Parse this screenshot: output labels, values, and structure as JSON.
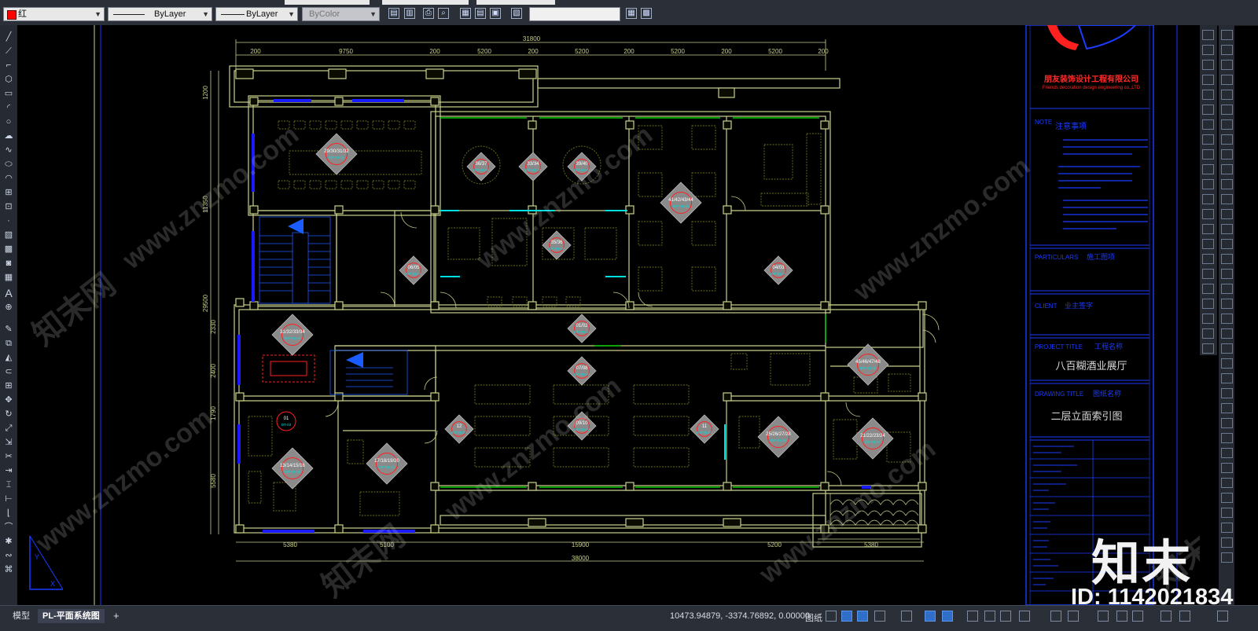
{
  "toolbar": {
    "color_value": "红",
    "linetype_value": "ByLayer",
    "lineweight_value": "ByLayer",
    "plotstyle_value": "ByColor"
  },
  "tabs": [
    {
      "label": "模型"
    },
    {
      "label": "PL-平面系统图"
    }
  ],
  "tab_add_label": "+",
  "status": {
    "coordinates": "10473.94879, -3374.76892, 0.00000",
    "paper_label": "图纸"
  },
  "drawing": {
    "dims_top": {
      "overall": "31800",
      "segments": [
        "9750",
        "5200",
        "5200",
        "5200",
        "5200"
      ],
      "small": [
        "200",
        "200",
        "200",
        "200",
        "200",
        "200"
      ]
    },
    "dims_bottom": {
      "overall": "38000",
      "segments": [
        "5380",
        "5100",
        "15900",
        "5200",
        "5380"
      ]
    },
    "dims_left": [
      "1200",
      "11350",
      "29500",
      "2330",
      "2400",
      "1790",
      "5580"
    ],
    "tags": [
      {
        "num": "29/30/31/32",
        "ref": "IDP-01-02"
      },
      {
        "num": "36/37",
        "ref": "IDP-01-03"
      },
      {
        "num": "33/34",
        "ref": "IDP-01-03"
      },
      {
        "num": "39/40",
        "ref": "IDP-01-03"
      },
      {
        "num": "41/42/43/44",
        "ref": "IDP-01-06"
      },
      {
        "num": "35/36",
        "ref": "IDP-01-03"
      },
      {
        "num": "06/05",
        "ref": "IDP-01-01"
      },
      {
        "num": "04/03",
        "ref": "IDP-01-01"
      },
      {
        "num": "31/32/33/34",
        "ref": "IDP-01-03"
      },
      {
        "num": "01/02",
        "ref": "IDP-01-01"
      },
      {
        "num": "07/08",
        "ref": "IDP-01-01"
      },
      {
        "num": "45/46/47/48",
        "ref": "IDP-01-09"
      },
      {
        "num": "09/10",
        "ref": "IDP-01-02"
      },
      {
        "num": "12",
        "ref": "IDP-01-02"
      },
      {
        "num": "11",
        "ref": "IDP-01-02"
      },
      {
        "num": "13/14/15/16",
        "ref": "IDP-01-05"
      },
      {
        "num": "17/18/19/20",
        "ref": "IDP-01-04"
      },
      {
        "num": "25/26/27/28",
        "ref": "IDP-01-08"
      },
      {
        "num": "21/22/23/24",
        "ref": "IDP-01-07"
      },
      {
        "num": "01",
        "ref": "DT-03"
      }
    ]
  },
  "titleblock": {
    "company_cn": "朋友装饰设计工程有限公司",
    "company_en": "Friends decoration design engineering co.,LTD",
    "notes_title": "注意事项",
    "notes_label": "NOTE",
    "particulars_label": "PARTICULARS",
    "particulars_value": "施工图项",
    "client_label": "CLIENT",
    "client_value": "业主签字",
    "project_title_label": "PROJECT TITLE",
    "project_title_cn": "工程名称",
    "project_name": "八百糊酒业展厅",
    "drawing_title_label": "DRAWING TITLE",
    "drawing_title_cn": "图纸名称",
    "drawing_name": "二层立面索引图"
  },
  "watermark": {
    "brand": "知末",
    "id_label": "ID: 1142021834",
    "site": "www.znzmo.com",
    "site_cn": "知末网"
  },
  "colors": {
    "wall": "#c9d08a",
    "window": "#1a1aff",
    "green": "#00c800",
    "cyan": "#00e0e0",
    "tag_fill": "#8a8a8a",
    "tag_ring": "#ff2020",
    "titleblock_line": "#1a3cff",
    "title_text": "#ff2a2a"
  }
}
